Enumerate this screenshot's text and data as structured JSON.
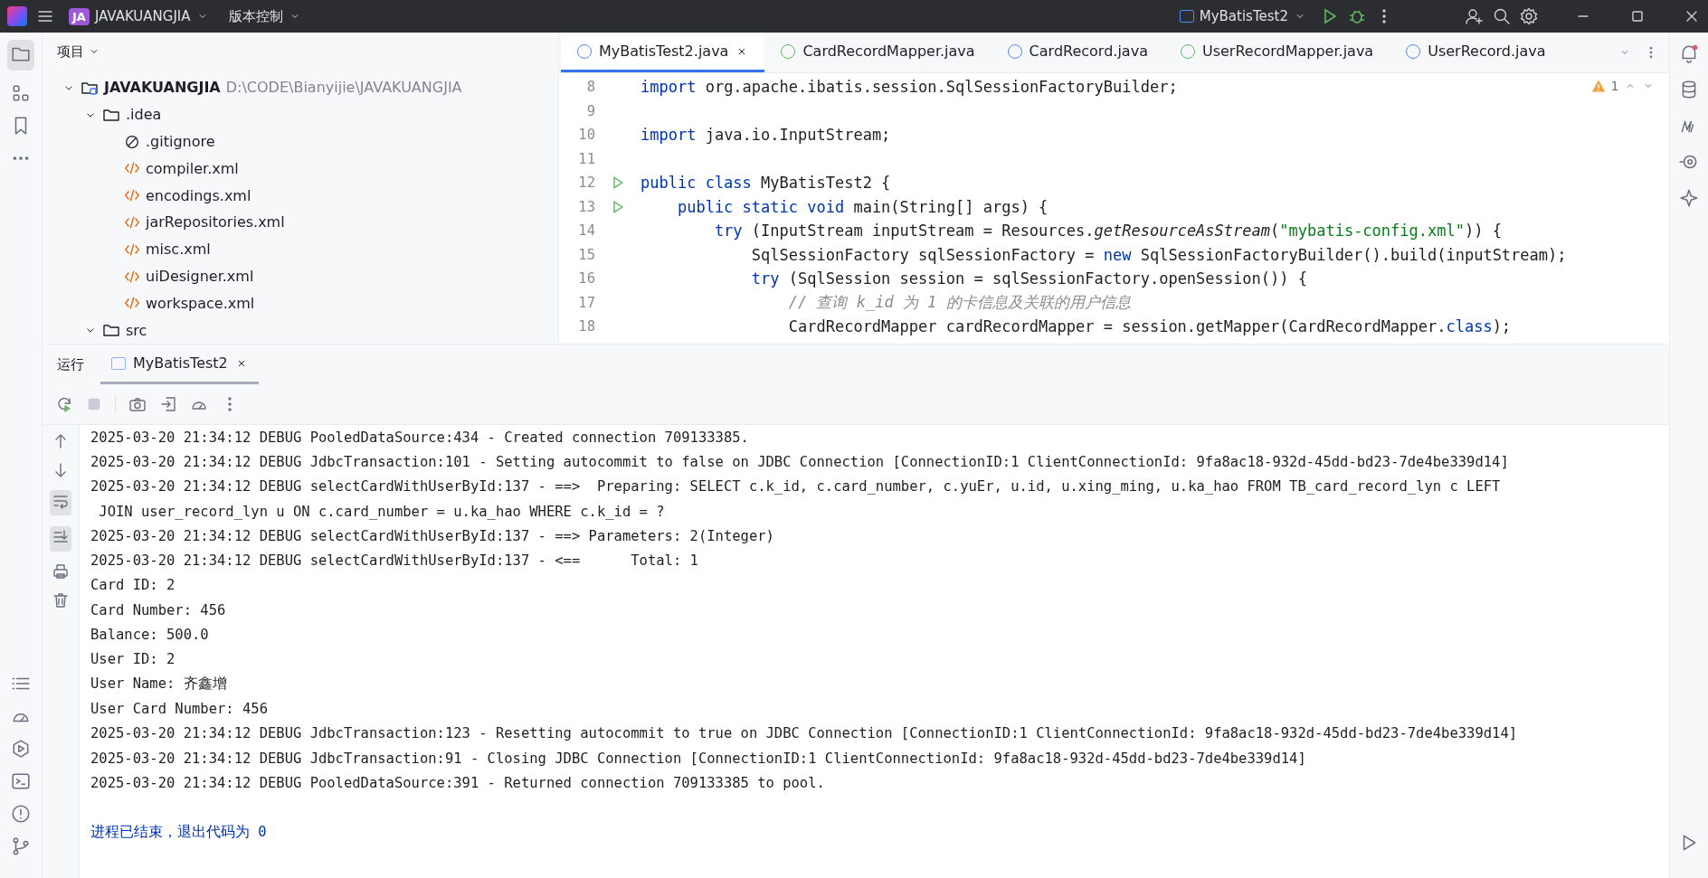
{
  "title_bar": {
    "project_badge": "JA",
    "project": "JAVAKUANGJIA",
    "vcs": "版本控制",
    "run_config": "MyBatisTest2"
  },
  "project_panel": {
    "title": "项目",
    "tree": [
      {
        "label": "JAVAKUANGJIA",
        "path": "D:\\CODE\\Bianyijie\\JAVAKUANGJIA",
        "kind": "module",
        "expanded": true,
        "children": [
          {
            "label": ".idea",
            "kind": "folder",
            "expanded": true,
            "children": [
              {
                "label": ".gitignore",
                "kind": "ignore"
              },
              {
                "label": "compiler.xml",
                "kind": "xml"
              },
              {
                "label": "encodings.xml",
                "kind": "xml"
              },
              {
                "label": "jarRepositories.xml",
                "kind": "xml"
              },
              {
                "label": "misc.xml",
                "kind": "xml"
              },
              {
                "label": "uiDesigner.xml",
                "kind": "xml"
              },
              {
                "label": "workspace.xml",
                "kind": "xml"
              }
            ]
          },
          {
            "label": "src",
            "kind": "folder",
            "expanded": true
          }
        ]
      }
    ]
  },
  "editor": {
    "tabs": [
      {
        "label": "MyBatisTest2.java",
        "kind": "class",
        "selected": true
      },
      {
        "label": "CardRecordMapper.java",
        "kind": "interface",
        "selected": false
      },
      {
        "label": "CardRecord.java",
        "kind": "class",
        "selected": false
      },
      {
        "label": "UserRecordMapper.java",
        "kind": "interface",
        "selected": false
      },
      {
        "label": "UserRecord.java",
        "kind": "class",
        "selected": false
      }
    ],
    "warning_count": "1",
    "lines": [
      {
        "number": "8",
        "runnable": false,
        "segments": [
          {
            "kind": "keyword",
            "text": "import"
          },
          {
            "kind": "plain",
            "text": " org.apache.ibatis.session.SqlSessionFactoryBuilder;"
          }
        ]
      },
      {
        "number": "9",
        "runnable": false
      },
      {
        "number": "10",
        "runnable": false,
        "segments": [
          {
            "kind": "keyword",
            "text": "import"
          },
          {
            "kind": "plain",
            "text": " java.io.InputStream;"
          }
        ]
      },
      {
        "number": "11",
        "runnable": false
      },
      {
        "number": "12",
        "runnable": true,
        "segments": [
          {
            "kind": "keyword",
            "text": "public class"
          },
          {
            "kind": "plain",
            "text": " MyBatisTest2 {"
          }
        ]
      },
      {
        "number": "13",
        "runnable": true,
        "segments": [
          {
            "kind": "keyword",
            "text": "    public static void"
          },
          {
            "kind": "plain",
            "text": " main(String[] args) {"
          }
        ]
      },
      {
        "number": "14",
        "runnable": false,
        "segments": [
          {
            "kind": "keyword",
            "text": "        try"
          },
          {
            "kind": "plain",
            "text": " (InputStream inputStream = Resources."
          },
          {
            "kind": "static",
            "text": "getResourceAsStream"
          },
          {
            "kind": "plain",
            "text": "("
          },
          {
            "kind": "string",
            "text": "\"mybatis-config.xml\""
          },
          {
            "kind": "plain",
            "text": ")) {"
          }
        ]
      },
      {
        "number": "15",
        "runnable": false,
        "segments": [
          {
            "kind": "plain",
            "text": "            SqlSessionFactory sqlSessionFactory = "
          },
          {
            "kind": "keyword",
            "text": "new"
          },
          {
            "kind": "plain",
            "text": " SqlSessionFactoryBuilder().build(inputStream);"
          }
        ]
      },
      {
        "number": "16",
        "runnable": false,
        "segments": [
          {
            "kind": "keyword",
            "text": "            try"
          },
          {
            "kind": "plain",
            "text": " (SqlSession session = sqlSessionFactory.openSession()) {"
          }
        ]
      },
      {
        "number": "17",
        "runnable": false,
        "segments": [
          {
            "kind": "comment",
            "text": "                // 查询 k_id 为 1 的卡信息及关联的用户信息"
          }
        ]
      },
      {
        "number": "18",
        "runnable": false,
        "segments": [
          {
            "kind": "plain",
            "text": "                CardRecordMapper cardRecordMapper = session.getMapper(CardRecordMapper."
          },
          {
            "kind": "keyword",
            "text": "class"
          },
          {
            "kind": "plain",
            "text": ");"
          }
        ]
      }
    ]
  },
  "run_panel": {
    "title": "运行",
    "tabs": [
      {
        "label": "MyBatisTest2",
        "selected": true
      }
    ],
    "console": [
      {
        "kind": "log",
        "text": "2025-03-20 21:34:12 DEBUG PooledDataSource:434 - Created connection 709133385."
      },
      {
        "kind": "log",
        "text": "2025-03-20 21:34:12 DEBUG JdbcTransaction:101 - Setting autocommit to false on JDBC Connection [ConnectionID:1 ClientConnectionId: 9fa8ac18-932d-45dd-bd23-7de4be339d14]"
      },
      {
        "kind": "log",
        "text": "2025-03-20 21:34:12 DEBUG selectCardWithUserById:137 - ==>  Preparing: SELECT c.k_id, c.card_number, c.yuEr, u.id, u.xing_ming, u.ka_hao FROM TB_card_record_lyn c LEFT"
      },
      {
        "kind": "log",
        "text": " JOIN user_record_lyn u ON c.card_number = u.ka_hao WHERE c.k_id = ?"
      },
      {
        "kind": "log",
        "text": "2025-03-20 21:34:12 DEBUG selectCardWithUserById:137 - ==> Parameters: 2(Integer)"
      },
      {
        "kind": "log",
        "text": "2025-03-20 21:34:12 DEBUG selectCardWithUserById:137 - <==      Total: 1"
      },
      {
        "kind": "log",
        "text": "Card ID: 2"
      },
      {
        "kind": "log",
        "text": "Card Number: 456"
      },
      {
        "kind": "log",
        "text": "Balance: 500.0"
      },
      {
        "kind": "log",
        "text": "User ID: 2"
      },
      {
        "kind": "log",
        "text": "User Name: 齐鑫增"
      },
      {
        "kind": "log",
        "text": "User Card Number: 456"
      },
      {
        "kind": "log",
        "text": "2025-03-20 21:34:12 DEBUG JdbcTransaction:123 - Resetting autocommit to true on JDBC Connection [ConnectionID:1 ClientConnectionId: 9fa8ac18-932d-45dd-bd23-7de4be339d14]"
      },
      {
        "kind": "log",
        "text": "2025-03-20 21:34:12 DEBUG JdbcTransaction:91 - Closing JDBC Connection [ConnectionID:1 ClientConnectionId: 9fa8ac18-932d-45dd-bd23-7de4be339d14]"
      },
      {
        "kind": "log",
        "text": "2025-03-20 21:34:12 DEBUG PooledDataSource:391 - Returned connection 709133385 to pool."
      },
      {
        "kind": "blank"
      },
      {
        "kind": "exit",
        "text": "进程已结束，退出代码为 0"
      }
    ]
  }
}
